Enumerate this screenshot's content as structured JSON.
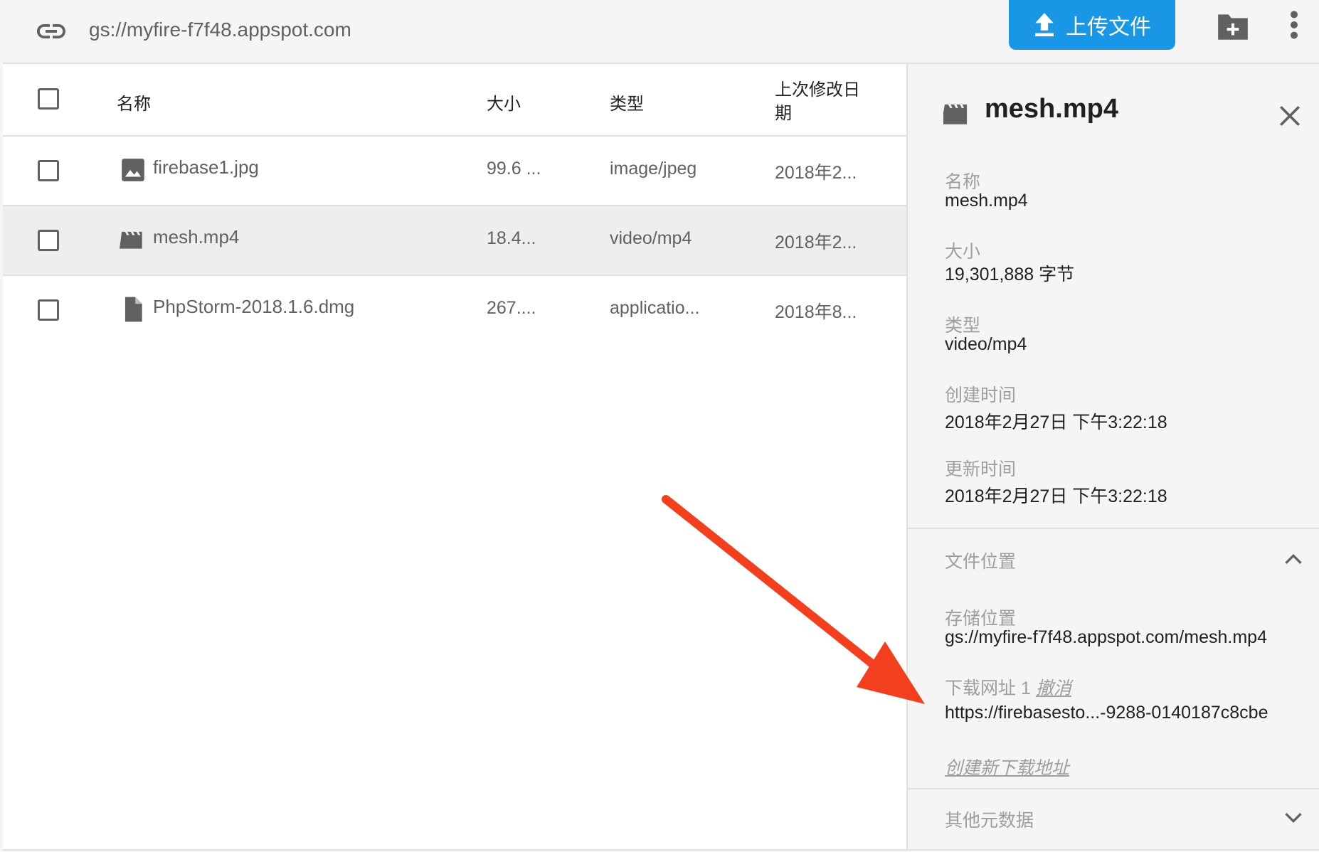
{
  "toolbar": {
    "bucket_url": "gs://myfire-f7f48.appspot.com",
    "upload_label": "上传文件"
  },
  "table": {
    "columns": [
      "名称",
      "大小",
      "类型",
      "上次修改日期"
    ],
    "column_date_line1": "上次修改日",
    "column_date_line2": "期",
    "rows": [
      {
        "name": "firebase1.jpg",
        "size": "99.6 ...",
        "type": "image/jpeg",
        "date": "2018年2...",
        "icon": "image-icon"
      },
      {
        "name": "mesh.mp4",
        "size": "18.4...",
        "type": "video/mp4",
        "date": "2018年2...",
        "icon": "movie-icon",
        "selected": true
      },
      {
        "name": "PhpStorm-2018.1.6.dmg",
        "size": "267....",
        "type": "applicatio...",
        "date": "2018年8...",
        "icon": "file-icon"
      }
    ]
  },
  "panel": {
    "title": "mesh.mp4",
    "fields": [
      {
        "label": "名称",
        "value": "mesh.mp4"
      },
      {
        "label": "大小",
        "value": "19,301,888 字节"
      },
      {
        "label": "类型",
        "value": "video/mp4"
      },
      {
        "label": "创建时间",
        "value": "2018年2月27日 下午3:22:18"
      },
      {
        "label": "更新时间",
        "value": "2018年2月27日 下午3:22:18"
      }
    ],
    "file_location": {
      "title": "文件位置",
      "storage_label": "存储位置",
      "storage_value": "gs://myfire-f7f48.appspot.com/mesh.mp4",
      "download_label": "下载网址 1",
      "revoke_label": "撤消",
      "download_value": "https://firebasesto...-9288-0140187c8cbe",
      "create_link_label": "创建新下载地址"
    },
    "other_metadata_title": "其他元数据"
  },
  "colors": {
    "accent": "#1a96e6",
    "annotation_arrow": "#f2401e"
  }
}
